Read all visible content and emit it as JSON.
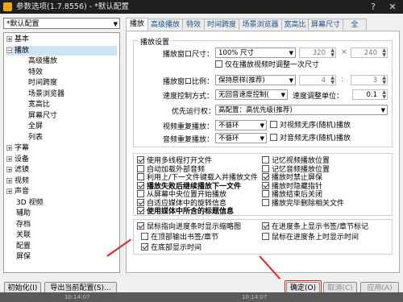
{
  "window": {
    "title": "参数选项(1.7.8556) - *默认配置",
    "help_label": "?",
    "close_label": "✕"
  },
  "profile": {
    "value": "*默认配置"
  },
  "tree": {
    "items": [
      {
        "label": "基本",
        "toggle": "+"
      },
      {
        "label": "播放",
        "toggle": "−"
      },
      {
        "label": "高级播放"
      },
      {
        "label": "特效"
      },
      {
        "label": "时间跨度"
      },
      {
        "label": "场景浏览器"
      },
      {
        "label": "宽高比"
      },
      {
        "label": "屏幕尺寸"
      },
      {
        "label": "全屏"
      },
      {
        "label": "列表"
      },
      {
        "label": "字幕",
        "toggle": "+"
      },
      {
        "label": "设备",
        "toggle": "+"
      },
      {
        "label": "滤镜",
        "toggle": "+"
      },
      {
        "label": "视频",
        "toggle": "+"
      },
      {
        "label": "声音",
        "toggle": "+"
      },
      {
        "label": "3D 视频"
      },
      {
        "label": "辅助"
      },
      {
        "label": "存档"
      },
      {
        "label": "关联"
      },
      {
        "label": "配置"
      },
      {
        "label": "屏保"
      }
    ]
  },
  "tabs": [
    "播放",
    "高级播放",
    "特效",
    "时间跨度",
    "场景浏览器",
    "宽高比",
    "屏幕尺寸",
    "全"
  ],
  "playback_settings": {
    "group_title": "播放设置",
    "window_size_label": "播放窗口尺寸：",
    "window_size_value": "100% 尺寸",
    "width_value": "320",
    "height_value": "240",
    "resize_once_label": "仅在播放视频时调整一次尺寸",
    "window_ratio_label": "播放窗口比例：",
    "window_ratio_value": "保持原样(推荐)",
    "ratio_w": "4",
    "ratio_h": "3",
    "speed_method_label": "速度控制方式：",
    "speed_method_value": "无回音速度控制(",
    "speed_unit_label": "速度调整单位：",
    "speed_unit_value": "0.1",
    "priority_label": "优先运行权：",
    "priority_value": "高配置：高优先级(推荐)",
    "video_repeat_label": "视频重复播放：",
    "video_repeat_value": "不循环",
    "video_random_label": "对视频无序(随机)播放",
    "audio_repeat_label": "音频重复播放：",
    "audio_repeat_value": "不循环",
    "audio_random_label": "对音频无序(随机)播放"
  },
  "options": {
    "left": [
      {
        "label": "使用多线程打开文件",
        "checked": true
      },
      {
        "label": "自动加载外部音频",
        "checked": false
      },
      {
        "label": "利用上/下一文件键载入并播放文件",
        "checked": false
      },
      {
        "label": "播放失败后继续播放下一文件",
        "checked": true,
        "bold": true
      },
      {
        "label": "从屏幕中央位置开始播放",
        "checked": false
      },
      {
        "label": "自适应媒体中的旋转信息",
        "checked": true
      },
      {
        "label": "使用媒体中所含的标题信息",
        "checked": true,
        "bold": true
      }
    ],
    "right": [
      {
        "label": "记忆视频播放位置",
        "checked": false
      },
      {
        "label": "记忆音频播放位置",
        "checked": false
      },
      {
        "label": "播放时禁止屏保",
        "checked": true
      },
      {
        "label": "播放时隐藏指针",
        "checked": true
      },
      {
        "label": "播放结束后关闭",
        "checked": false
      },
      {
        "label": "播放完毕删除相关文件",
        "checked": false
      }
    ]
  },
  "thumbnails": {
    "hover_label": "鼠标指向进度条时显示缩略图",
    "hover_checked": true,
    "top_output_label": "在顶部输出书签/章节",
    "top_output_checked": false,
    "bottom_time_label": "在底部显示时间",
    "bottom_time_checked": true,
    "show_marks_label": "在进度条上显示书签/章节标记",
    "show_marks_checked": true,
    "hover_time_label": "鼠标在进度条上时显示时间",
    "hover_time_checked": false
  },
  "buttons": {
    "init": "初始化(I)",
    "export": "导出当前配置(S)...",
    "ok": "确定(O)",
    "cancel": "取消(C)",
    "apply": "应用(A)"
  },
  "taskbar": {
    "time_left": "10:14:07",
    "time_right": "10:14:07"
  },
  "colors": {
    "annotation": "#e02020",
    "title_bg": "#1f1f1f",
    "selected_item": "#cfe3f7"
  }
}
